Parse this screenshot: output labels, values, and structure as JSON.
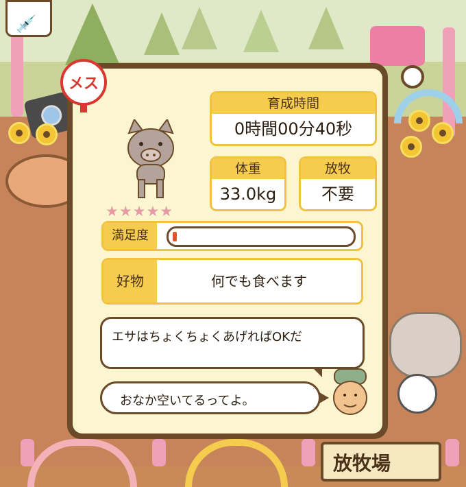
{
  "badge": {
    "label": "メス"
  },
  "pig": {
    "star_count": 5,
    "stars": "★★★★★"
  },
  "stats": {
    "time_label": "育成時間",
    "time_value": "0時間00分40秒",
    "weight_label": "体重",
    "weight_value": "33.0kg",
    "grazing_label": "放牧",
    "grazing_value": "不要"
  },
  "satisfaction": {
    "label": "満足度",
    "level": 0.02
  },
  "favorite": {
    "label": "好物",
    "value": "何でも食べます"
  },
  "messages": {
    "hint": "エサはちょくちょくあげればOKだ",
    "speech": "おなか空いてるってよ。"
  },
  "bottom_sign": {
    "label": "放牧場"
  },
  "colors": {
    "panel_border": "#6b4a2a",
    "panel_bg": "#fbf6cf",
    "accent_yellow": "#f6cc4e",
    "bar_fill": "#d9572b",
    "badge_red": "#d9372f"
  }
}
